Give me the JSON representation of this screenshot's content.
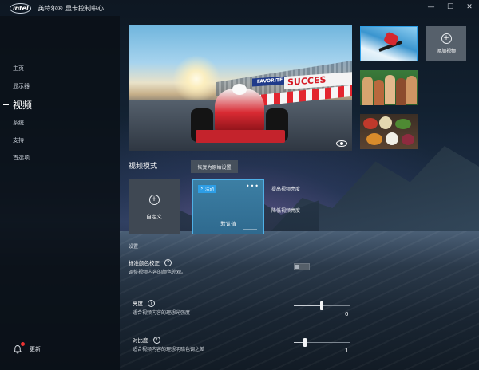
{
  "app": {
    "logo_text": "intel",
    "title": "英特尔® 显卡控制中心",
    "window_controls": [
      "—",
      "☐",
      "✕"
    ]
  },
  "sidebar": {
    "items": [
      {
        "label": "主页"
      },
      {
        "label": "显示器"
      },
      {
        "label": "视频"
      },
      {
        "label": "系统"
      },
      {
        "label": "支持"
      },
      {
        "label": "首选项"
      }
    ],
    "active_index": 2,
    "update_label": "更新"
  },
  "preview": {
    "banner_text": "SUCCES",
    "banner2_text": "FAVORITE"
  },
  "thumbnails": [
    {
      "name": "snowboard-thumbnail",
      "selected": true
    },
    {
      "name": "people-thumbnail",
      "selected": false
    },
    {
      "name": "food-thumbnail",
      "selected": false
    }
  ],
  "add_video": {
    "label": "添加视频"
  },
  "video_mode": {
    "title": "视频模式",
    "reset_label": "恢复为原始设置",
    "custom_label": "自定义",
    "default_label": "默认值",
    "active_badge": "活动",
    "more": "•••",
    "options": [
      "提高视频亮度",
      "降低视频亮度"
    ]
  },
  "settings": {
    "section_label": "设置",
    "color_correction": {
      "title": "标准颜色校正",
      "description": "调整视频内容的颜色外观。",
      "enabled": false
    },
    "brightness": {
      "title": "亮度",
      "description": "适合视频内容的理想光强度",
      "value": "0",
      "min": -100,
      "max": 100
    },
    "contrast": {
      "title": "对比度",
      "description": "适合视频内容的理想明暗色调之差",
      "value": "1",
      "min": 0,
      "max": 5
    }
  },
  "colors": {
    "accent": "#2d9ee6",
    "sidebar_bg": "#0a1017",
    "notification_dot": "#e33333"
  }
}
